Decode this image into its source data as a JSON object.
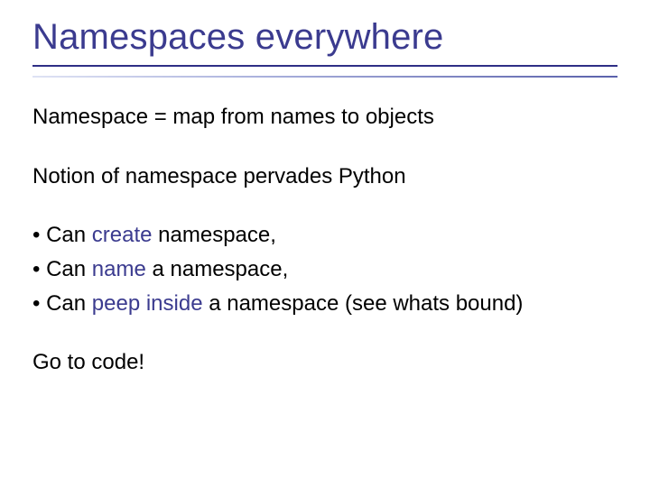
{
  "title": "Namespaces everywhere",
  "paragraphs": {
    "p1": "Namespace = map from names to objects",
    "p2": "Notion of namespace pervades Python",
    "p3": "Go to code!"
  },
  "bullets": [
    {
      "pre": "Can ",
      "emph": "create",
      "post": " namespace,"
    },
    {
      "pre": "Can ",
      "emph": "name",
      "post": " a namespace,"
    },
    {
      "pre": "Can ",
      "emph": "peep inside",
      "post": " a namespace (see whats bound)"
    }
  ]
}
